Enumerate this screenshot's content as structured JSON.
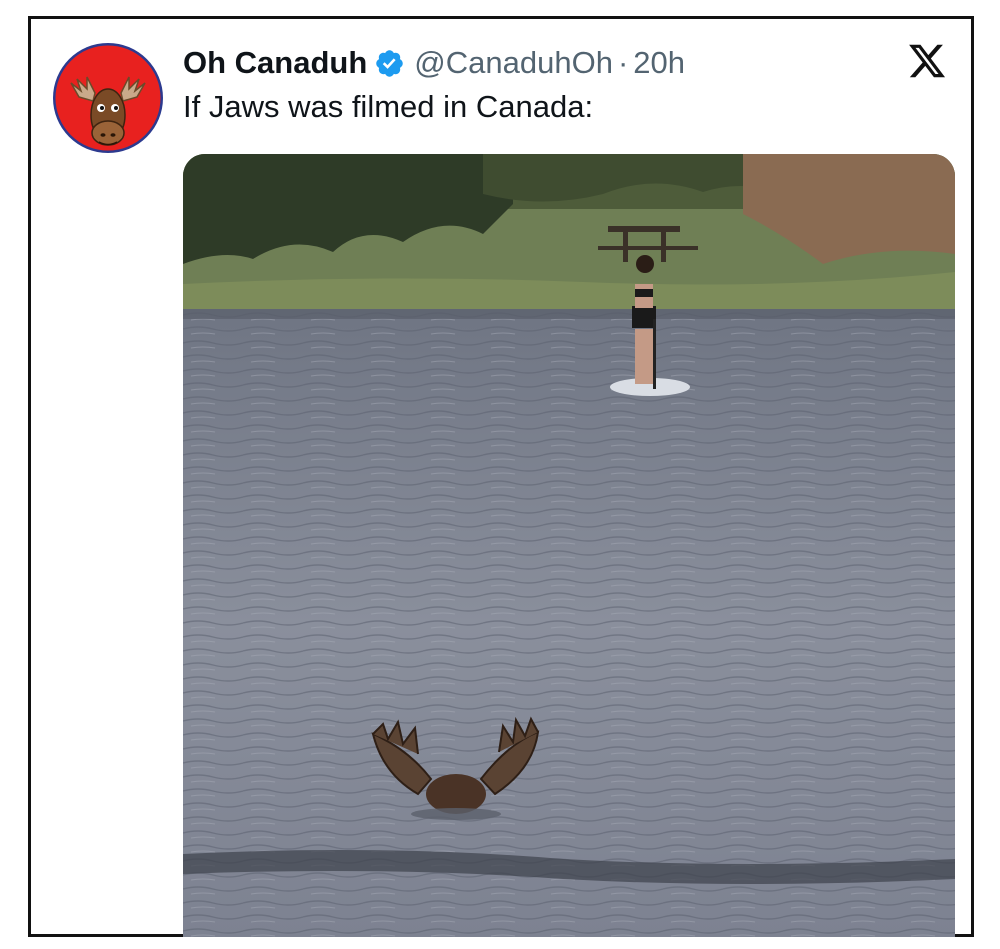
{
  "tweet": {
    "author_name": "Oh Canaduh",
    "handle": "@CanaduhOh",
    "separator": "·",
    "timestamp": "20h",
    "text": "If Jaws was filmed in Canada:",
    "verified": true
  },
  "icons": {
    "avatar": "moose-cartoon-avatar",
    "verified": "verified-badge-icon",
    "platform": "x-logo-icon"
  },
  "colors": {
    "verified_badge": "#1d9bf0",
    "avatar_background": "#e8211f",
    "text_primary": "#0f1419",
    "text_secondary": "#536471"
  }
}
